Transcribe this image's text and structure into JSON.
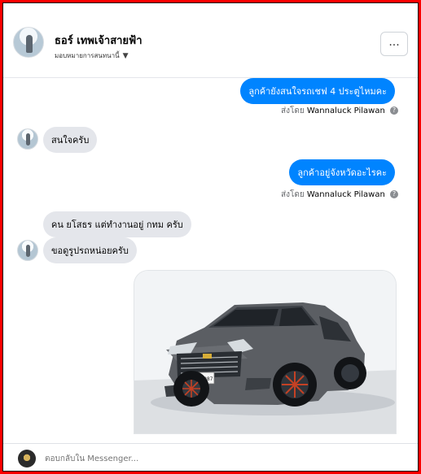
{
  "header": {
    "name": "ธอร์ เทพเจ้าสายฟ้า",
    "assignment": "มอบหมายการสนทนานี้",
    "more_label": "..."
  },
  "messages": [
    {
      "type": "outgoing",
      "text": "ลูกค้ายังสนใจรถเชฟ 4 ประตูไหมคะ"
    },
    {
      "type": "sent_by",
      "prefix": "ส่งโดย",
      "name": "Wannaluck Pilawan"
    },
    {
      "type": "incoming",
      "text": "สนใจครับ"
    },
    {
      "type": "outgoing",
      "text": "ลูกค้าอยู่จังหวัดอะไรคะ"
    },
    {
      "type": "sent_by",
      "prefix": "ส่งโดย",
      "name": "Wannaluck Pilawan"
    },
    {
      "type": "incoming",
      "text": "คน ยโสธร แต่ทำงานอยู่ กทม ครับ"
    },
    {
      "type": "incoming",
      "text": "ขอดูรูปรถหน่อยครับ"
    },
    {
      "type": "image",
      "plate": "กล 1987"
    }
  ],
  "composer": {
    "placeholder": "ตอบกลับใน Messenger..."
  },
  "colors": {
    "frame": "#ff0000",
    "outgoing": "#0084ff",
    "incoming": "#e4e6eb",
    "meta": "#65676b"
  },
  "icons": [
    "info-icon",
    "caret-down-icon",
    "more-icon"
  ]
}
